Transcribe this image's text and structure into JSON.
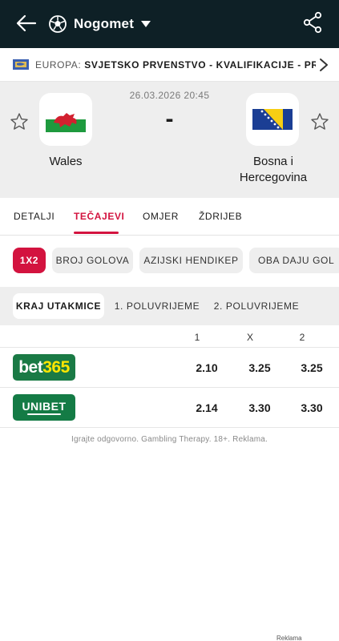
{
  "header": {
    "sport": "Nogomet",
    "back_icon": "arrow-left-icon",
    "sport_icon": "soccer-ball-icon",
    "dropdown_icon": "caret-down-icon",
    "share_icon": "share-icon"
  },
  "league": {
    "prefix": "EUROPA: ",
    "name": "SVJETSKO PRVENSTVO - KVALIFIKACIJE - PR...",
    "flag_icon": "europe-flag-icon",
    "chevron_icon": "chevron-right-icon"
  },
  "match": {
    "datetime": "26.03.2026 20:45",
    "score": "-",
    "home": {
      "name": "Wales"
    },
    "away": {
      "name_line1": "Bosna i",
      "name_line2": "Hercegovina"
    }
  },
  "tabs": [
    "DETALJI",
    "TEČAJEVI",
    "OMJER",
    "ŽDRIJEB"
  ],
  "active_tab": "TEČAJEVI",
  "markets": [
    "1X2",
    "BROJ GOLOVA",
    "AZIJSKI HENDIKEP",
    "OBA DAJU GOL"
  ],
  "active_market": "1X2",
  "periods": [
    "KRAJ UTAKMICE",
    "1. POLUVRIJEME",
    "2. POLUVRIJEME"
  ],
  "active_period": "KRAJ UTAKMICE",
  "odds_header": [
    "1",
    "X",
    "2"
  ],
  "odds": [
    {
      "bookmaker": "bet365",
      "book_a": "bet",
      "book_b": "365",
      "values": [
        "2.10",
        "3.25",
        "3.25"
      ]
    },
    {
      "bookmaker": "UNIBET",
      "values": [
        "2.14",
        "3.30",
        "3.30"
      ]
    }
  ],
  "disclaimer": "Igrajte odgovorno. Gambling Therapy. 18+. Reklama.",
  "ad_label": "Reklama",
  "colors": {
    "topbar": "#0e2026",
    "accent": "#d3133f",
    "panel": "#eeeeee",
    "bet365": "#1a7a45",
    "unibet": "#147b45"
  }
}
